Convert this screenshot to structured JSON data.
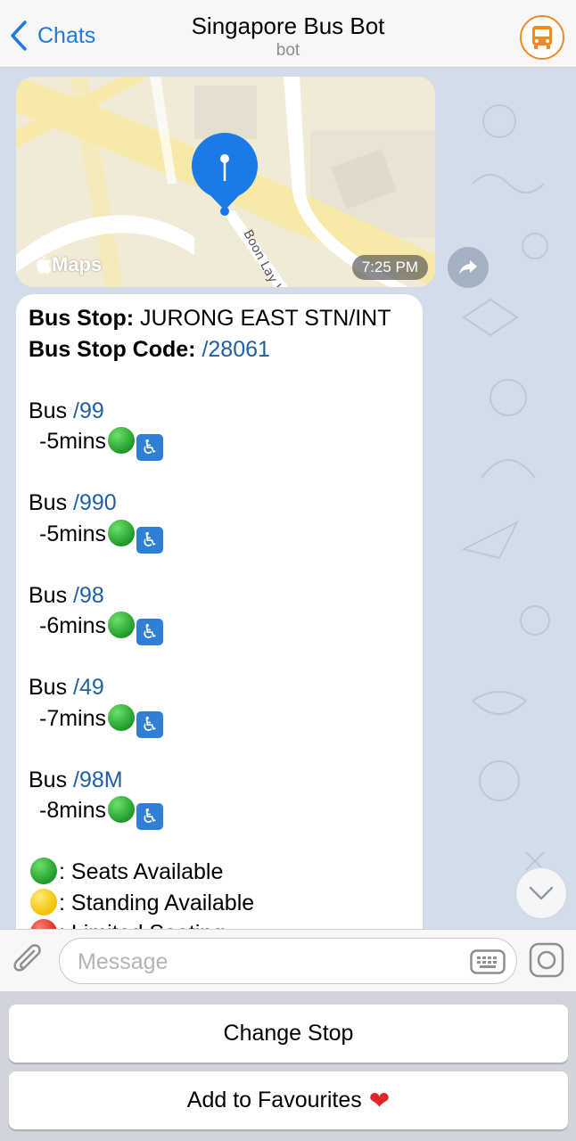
{
  "header": {
    "back_label": "Chats",
    "title": "Singapore Bus Bot",
    "subtitle": "bot"
  },
  "location_message": {
    "street_label": "Boon Lay Wa",
    "provider_label": "Maps",
    "time": "7:25 PM"
  },
  "bus_message": {
    "stop_label": "Bus Stop:",
    "stop_name": "JURONG EAST STN/INT",
    "code_label": "Bus Stop Code:",
    "code_link": "/28061",
    "buses": [
      {
        "prefix": "Bus",
        "number": "/99",
        "eta": "-5mins"
      },
      {
        "prefix": "Bus",
        "number": "/990",
        "eta": "-5mins"
      },
      {
        "prefix": "Bus",
        "number": "/98",
        "eta": "-6mins"
      },
      {
        "prefix": "Bus",
        "number": "/49",
        "eta": "-7mins"
      },
      {
        "prefix": "Bus",
        "number": "/98M",
        "eta": "-8mins"
      }
    ],
    "legend": [
      {
        "color": "green",
        "text": ": Seats Available"
      },
      {
        "color": "yellow",
        "text": ": Standing Available"
      },
      {
        "color": "red",
        "text": ": Limited Seating"
      }
    ]
  },
  "input": {
    "placeholder": "Message"
  },
  "reply_keyboard": {
    "change_stop": "Change Stop",
    "add_favourites": "Add to Favourites"
  },
  "colors": {
    "accent": "#1f7ae0",
    "link": "#1f5fa8",
    "avatar_ring": "#f08a24"
  }
}
